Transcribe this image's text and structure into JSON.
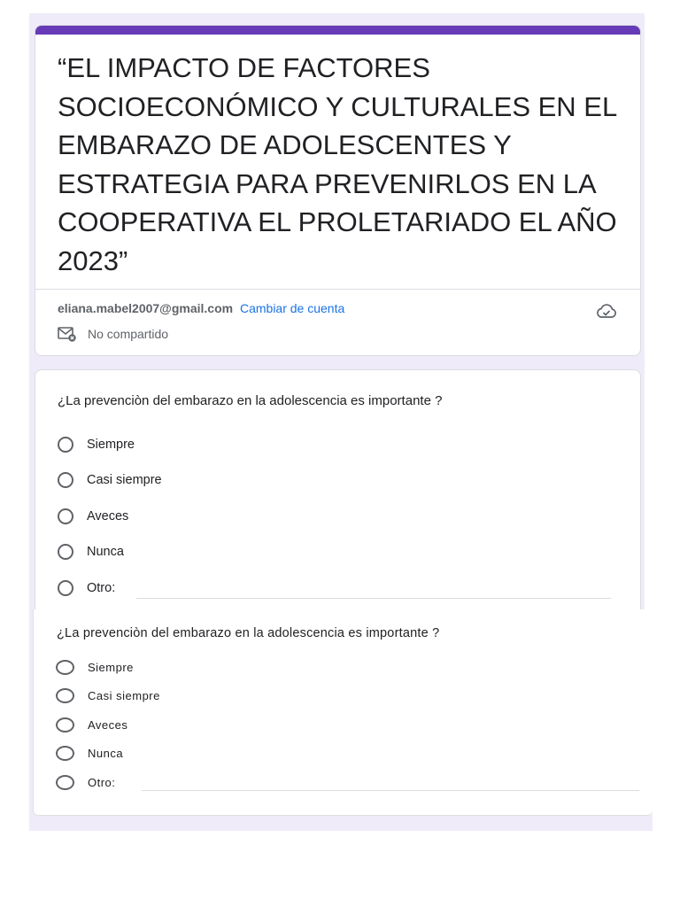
{
  "colors": {
    "accent": "#673ab7",
    "link": "#1a73e8",
    "background": "#f0ebf8"
  },
  "header": {
    "title": "“EL IMPACTO DE FACTORES SOCIOECONÓMICO Y CULTURALES EN EL EMBARAZO DE ADOLESCENTES Y ESTRATEGIA PARA  PREVENIRLOS EN LA COOPERATIVA EL PROLETARIADO EL AÑO 2023”",
    "email": "eliana.mabel2007@gmail.com",
    "switch_account": "Cambiar de cuenta",
    "share_status": "No compartido",
    "share_icon": "mail-not-shared-icon",
    "cloud_icon": "cloud-saved-icon"
  },
  "question1": {
    "title": "¿La prevenciòn del embarazo en la adolescencia es importante ?",
    "options": [
      "Siempre",
      "Casi siempre",
      "Aveces",
      "Nunca"
    ],
    "other_label": "Otro:"
  },
  "question2": {
    "title": "¿La prevenciòn del embarazo en la adolescencia es importante ?",
    "options": [
      "Siempre",
      "Casi siempre",
      "Aveces",
      "Nunca"
    ],
    "other_label": "Otro:"
  }
}
